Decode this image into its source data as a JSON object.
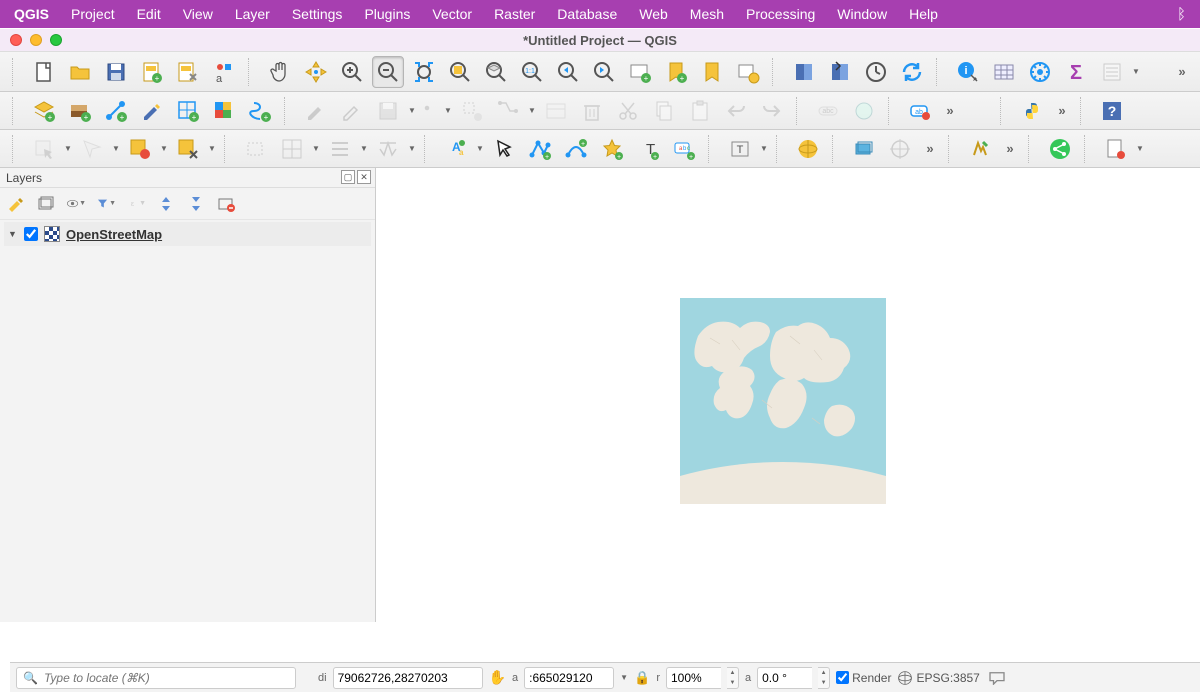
{
  "menubar": {
    "app": "QGIS",
    "items": [
      "Project",
      "Edit",
      "View",
      "Layer",
      "Settings",
      "Plugins",
      "Vector",
      "Raster",
      "Database",
      "Web",
      "Mesh",
      "Processing",
      "Window",
      "Help"
    ]
  },
  "window": {
    "title": "*Untitled Project — QGIS"
  },
  "layers_panel": {
    "title": "Layers",
    "layer": {
      "name": "OpenStreetMap",
      "checked": true
    }
  },
  "statusbar": {
    "locator_placeholder": "Type to locate (⌘K)",
    "coord_label": "di",
    "coord_value": "79062726,28270203",
    "scale_label": "a",
    "scale_value": ":665029120",
    "magnifier_label": "r",
    "magnifier_value": "100%",
    "rotation_label": "a",
    "rotation_value": "0.0 °",
    "render_label": "Render",
    "crs": "EPSG:3857"
  }
}
